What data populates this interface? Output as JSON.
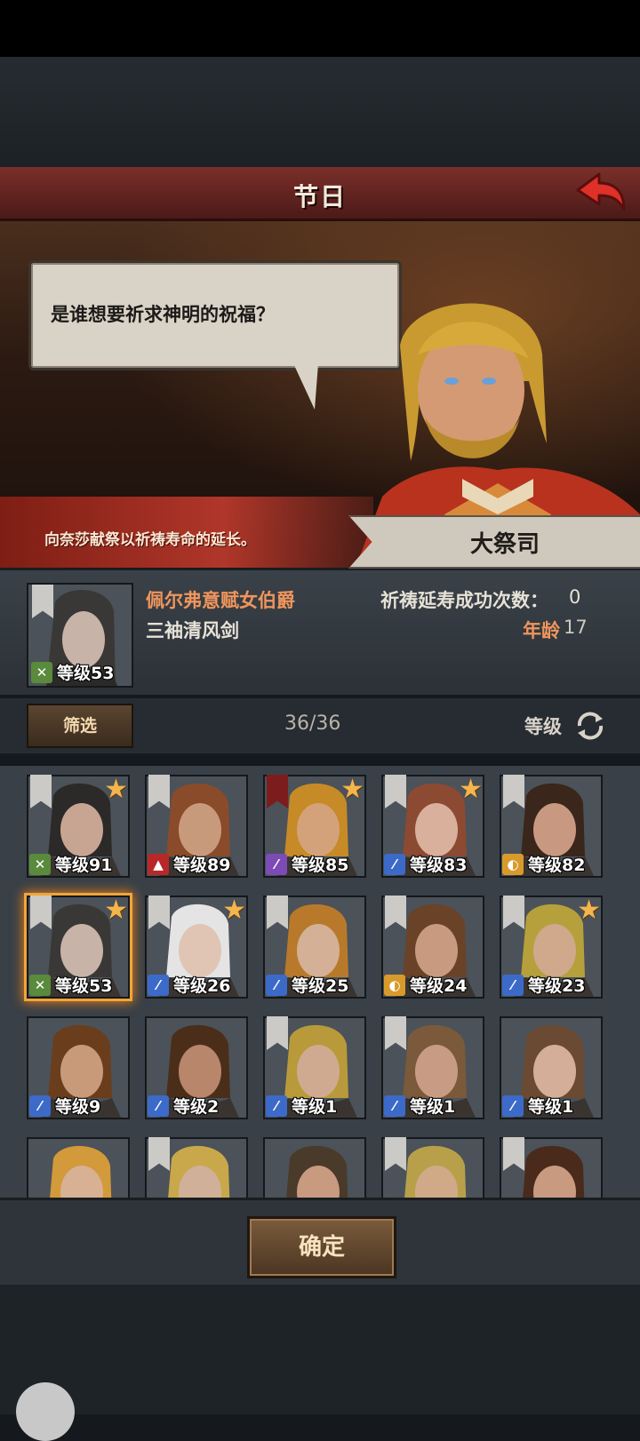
{
  "screen": {
    "title": "节日",
    "dialog": "是谁想要祈求神明的祝福？",
    "ribbon": "向奈莎献祭以祈祷寿命的延长。",
    "npc_name": "大祭司"
  },
  "selected_hero": {
    "name": "佩尔弗意赋女伯爵",
    "subtitle": "三袖清风剑",
    "pray_label": "祈祷延寿成功次数：",
    "pray_count": "0",
    "age_label": "年龄",
    "age": "17",
    "level_text": "等级53"
  },
  "filter": {
    "button": "筛选",
    "count": "36/36",
    "sort": "等级"
  },
  "heroes": [
    {
      "level": "等级91",
      "class": "archer",
      "class_glyph": "✕",
      "class_color": "#5a8a3c",
      "star": true,
      "banner": "white",
      "skin": "#c8a592",
      "hair": "#2b2a28"
    },
    {
      "level": "等级89",
      "class": "beast",
      "class_glyph": "▲",
      "class_color": "#b82828",
      "star": false,
      "banner": "white",
      "skin": "#c89a7c",
      "hair": "#8a4b2a"
    },
    {
      "level": "等级85",
      "class": "mage",
      "class_glyph": "⁄",
      "class_color": "#7c4bb5",
      "star": true,
      "banner": "red",
      "skin": "#d4a27a",
      "hair": "#c68a26"
    },
    {
      "level": "等级83",
      "class": "sword",
      "class_glyph": "⁄",
      "class_color": "#3c6ac8",
      "star": true,
      "banner": "white",
      "skin": "#d8b09c",
      "hair": "#8c4a32"
    },
    {
      "level": "等级82",
      "class": "shield",
      "class_glyph": "◐",
      "class_color": "#d89a2a",
      "star": false,
      "banner": "white",
      "skin": "#c89880",
      "hair": "#3a261a"
    },
    {
      "level": "等级53",
      "class": "archer",
      "class_glyph": "✕",
      "class_color": "#5a8a3c",
      "star": true,
      "banner": "white",
      "skin": "#c7b3a8",
      "hair": "#3a3836",
      "selected": true
    },
    {
      "level": "等级26",
      "class": "sword",
      "class_glyph": "⁄",
      "class_color": "#3c6ac8",
      "star": true,
      "banner": "white",
      "skin": "#e0c4b4",
      "hair": "#e4e4e4"
    },
    {
      "level": "等级25",
      "class": "sword",
      "class_glyph": "⁄",
      "class_color": "#3c6ac8",
      "star": false,
      "banner": "white",
      "skin": "#d4b096",
      "hair": "#b87a2a"
    },
    {
      "level": "等级24",
      "class": "shield",
      "class_glyph": "◐",
      "class_color": "#d89a2a",
      "star": false,
      "banner": "white",
      "skin": "#c89a80",
      "hair": "#6a4228"
    },
    {
      "level": "等级23",
      "class": "sword",
      "class_glyph": "⁄",
      "class_color": "#3c6ac8",
      "star": true,
      "banner": "white",
      "skin": "#d0a88c",
      "hair": "#b6a03c"
    },
    {
      "level": "等级9",
      "class": "sword",
      "class_glyph": "⁄",
      "class_color": "#3c6ac8",
      "star": false,
      "banner": "none",
      "skin": "#c89a7a",
      "hair": "#6a3e1c"
    },
    {
      "level": "等级2",
      "class": "sword",
      "class_glyph": "⁄",
      "class_color": "#3c6ac8",
      "star": false,
      "banner": "none",
      "skin": "#b8866a",
      "hair": "#4a2e1a"
    },
    {
      "level": "等级1",
      "class": "sword",
      "class_glyph": "⁄",
      "class_color": "#3c6ac8",
      "star": false,
      "banner": "white",
      "skin": "#d0aa90",
      "hair": "#b89a3a"
    },
    {
      "level": "等级1",
      "class": "sword",
      "class_glyph": "⁄",
      "class_color": "#3c6ac8",
      "star": false,
      "banner": "white",
      "skin": "#c89c84",
      "hair": "#7a5a3a"
    },
    {
      "level": "等级1",
      "class": "sword",
      "class_glyph": "⁄",
      "class_color": "#3c6ac8",
      "star": false,
      "banner": "none",
      "skin": "#d4ae98",
      "hair": "#6a4a32"
    },
    {
      "level": "",
      "class": "",
      "class_glyph": "",
      "class_color": "",
      "star": false,
      "banner": "none",
      "skin": "#d8b094",
      "hair": "#d29a3a"
    },
    {
      "level": "",
      "class": "",
      "class_glyph": "",
      "class_color": "",
      "star": false,
      "banner": "white",
      "skin": "#d0b098",
      "hair": "#c8a84a"
    },
    {
      "level": "",
      "class": "",
      "class_glyph": "",
      "class_color": "",
      "star": false,
      "banner": "none",
      "skin": "#c89a80",
      "hair": "#4a3a2a"
    },
    {
      "level": "",
      "class": "",
      "class_glyph": "",
      "class_color": "",
      "star": false,
      "banner": "white",
      "skin": "#d0aa88",
      "hair": "#b8a04a"
    },
    {
      "level": "",
      "class": "",
      "class_glyph": "",
      "class_color": "",
      "star": false,
      "banner": "white",
      "skin": "#c89a80",
      "hair": "#4a2a1a"
    }
  ],
  "confirm_button": "确定"
}
